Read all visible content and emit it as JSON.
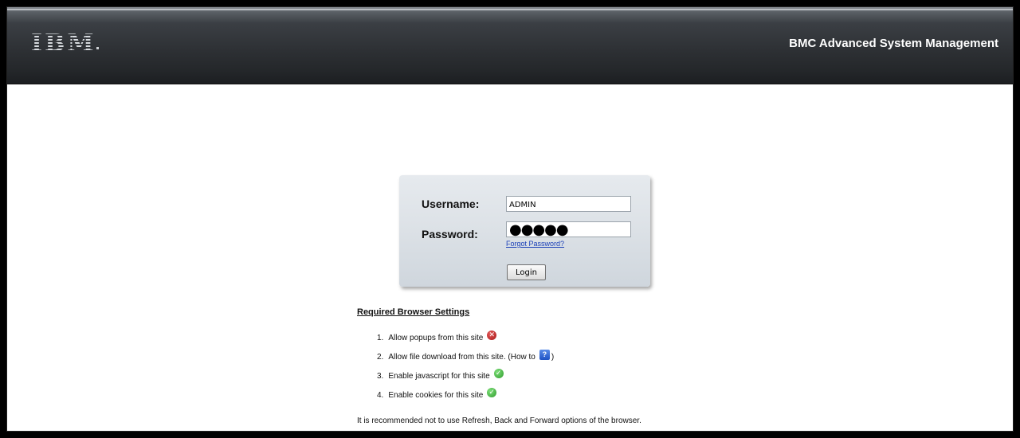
{
  "header": {
    "logo": "IBM",
    "title": "BMC Advanced System Management"
  },
  "login": {
    "username_label": "Username:",
    "username_value": "ADMIN",
    "password_label": "Password:",
    "password_value": "●●●●●",
    "forgot_link": "Forgot Password?",
    "login_button": "Login"
  },
  "requirements": {
    "title": "Required Browser Settings",
    "items": [
      {
        "num": "1.",
        "text": "Allow popups from this site",
        "status_icon": "error-icon"
      },
      {
        "num": "2.",
        "text": "Allow file download from this site. (How to",
        "suffix": ")",
        "status_icon": "help-icon",
        "icon_glyph": "?"
      },
      {
        "num": "3.",
        "text": "Enable javascript for this site",
        "status_icon": "check-icon"
      },
      {
        "num": "4.",
        "text": "Enable cookies for this site",
        "status_icon": "check-icon"
      }
    ],
    "note": "It is recommended not to use Refresh, Back and Forward options of the browser."
  },
  "colors": {
    "header_dark": "#24272a",
    "link_blue": "#1a3fb8",
    "error_red": "#a71616",
    "ok_green": "#2e9a2c"
  }
}
